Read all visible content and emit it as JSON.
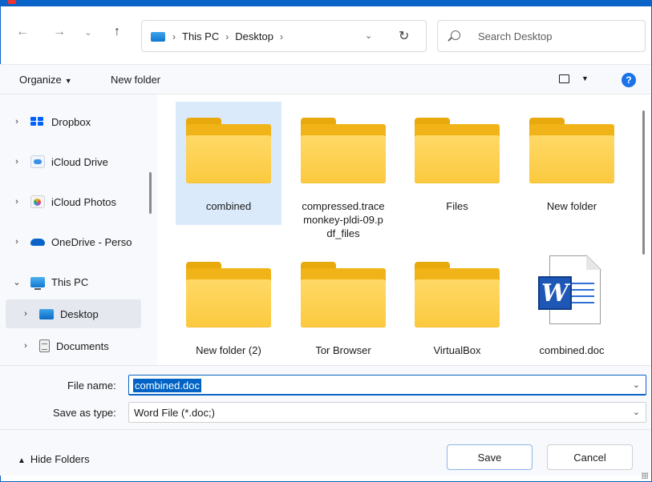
{
  "window": {
    "accent": "#0a64c8"
  },
  "address": {
    "crumbs": [
      "This PC",
      "Desktop"
    ],
    "sep": "›"
  },
  "search": {
    "placeholder": "Search Desktop"
  },
  "commandbar": {
    "organize": "Organize",
    "new_folder": "New folder"
  },
  "nav": {
    "items": [
      {
        "label": "Dropbox",
        "icon": "dropbox-icon"
      },
      {
        "label": "iCloud Drive",
        "icon": "icloud-drive-icon"
      },
      {
        "label": "iCloud Photos",
        "icon": "icloud-photos-icon"
      },
      {
        "label": "OneDrive - Perso",
        "icon": "onedrive-icon"
      },
      {
        "label": "This PC",
        "icon": "this-pc-icon"
      },
      {
        "label": "Desktop",
        "icon": "desktop-icon"
      },
      {
        "label": "Documents",
        "icon": "documents-icon"
      }
    ]
  },
  "files": [
    {
      "name": "combined",
      "type": "folder"
    },
    {
      "name": "compressed.tracemonkey-pldi-09.pdf_files",
      "type": "folder"
    },
    {
      "name": "Files",
      "type": "folder"
    },
    {
      "name": "New folder",
      "type": "folder"
    },
    {
      "name": "New folder (2)",
      "type": "folder"
    },
    {
      "name": "Tor Browser",
      "type": "folder"
    },
    {
      "name": "VirtualBox",
      "type": "folder"
    },
    {
      "name": "combined.doc",
      "type": "word-document"
    }
  ],
  "form": {
    "file_name_label": "File name:",
    "file_name_value": "combined.doc",
    "save_type_label": "Save as type:",
    "save_type_value": "Word File (*.doc;)"
  },
  "footer": {
    "hide_folders": "Hide Folders",
    "save": "Save",
    "cancel": "Cancel"
  }
}
